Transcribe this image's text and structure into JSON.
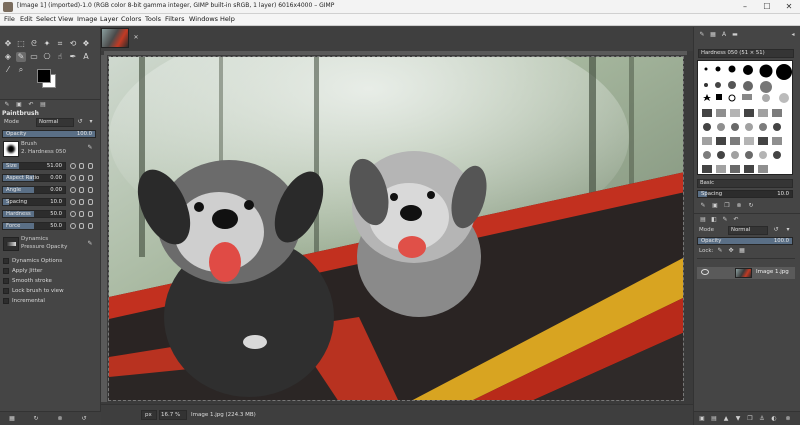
{
  "window": {
    "title": "[Image 1] (imported)-1.0 (RGB color 8-bit gamma integer, GIMP built-in sRGB, 1 layer) 6016x4000 – GIMP",
    "minimize": "–",
    "maximize": "☐",
    "close": "✕"
  },
  "menu": [
    "File",
    "Edit",
    "Select",
    "View",
    "Image",
    "Layer",
    "Colors",
    "Tools",
    "Filters",
    "Windows",
    "Help"
  ],
  "tool_options": {
    "title": "Paintbrush",
    "mode_label": "Mode",
    "mode_value": "Normal",
    "opacity_label": "Opacity",
    "opacity_value": "100.0",
    "opacity_fraction": 1.0,
    "brush_label": "Brush",
    "brush_name": "2. Hardness 050",
    "sliders": [
      {
        "label": "Size",
        "value": "51.00",
        "fraction": 0.25
      },
      {
        "label": "Aspect Ratio",
        "value": "0.00",
        "fraction": 0.5
      },
      {
        "label": "Angle",
        "value": "0.00",
        "fraction": 0.5
      },
      {
        "label": "Spacing",
        "value": "10.0",
        "fraction": 0.1
      },
      {
        "label": "Hardness",
        "value": "50.0",
        "fraction": 0.5
      },
      {
        "label": "Force",
        "value": "50.0",
        "fraction": 0.5
      }
    ],
    "dynamics_label": "Dynamics",
    "dynamics_value": "Pressure Opacity",
    "options": [
      {
        "label": "Dynamics Options",
        "checked": false
      },
      {
        "label": "Apply Jitter",
        "checked": false
      },
      {
        "label": "Smooth stroke",
        "checked": false
      },
      {
        "label": "Lock brush to view",
        "checked": false
      },
      {
        "label": "Incremental",
        "checked": false
      }
    ]
  },
  "status": {
    "unit": "px",
    "zoom": "16.7 %",
    "file_info": "Image 1.jpg (224.3 MB)"
  },
  "brushes": {
    "filter_value": "Hardness 050 (51 × 51)",
    "tag_value": "Basic",
    "spacing_label": "Spacing",
    "spacing_value": "10.0"
  },
  "layers": {
    "mode_label": "Mode",
    "mode_value": "Normal",
    "opacity_label": "Opacity",
    "opacity_value": "100.0",
    "lock_label": "Lock:",
    "items": [
      {
        "name": "Image 1.jpg"
      }
    ]
  },
  "colors": {
    "panel_bg": "#454545",
    "accent": "#5a6f86",
    "fg_color": "#000000",
    "bg_color": "#ffffff"
  }
}
